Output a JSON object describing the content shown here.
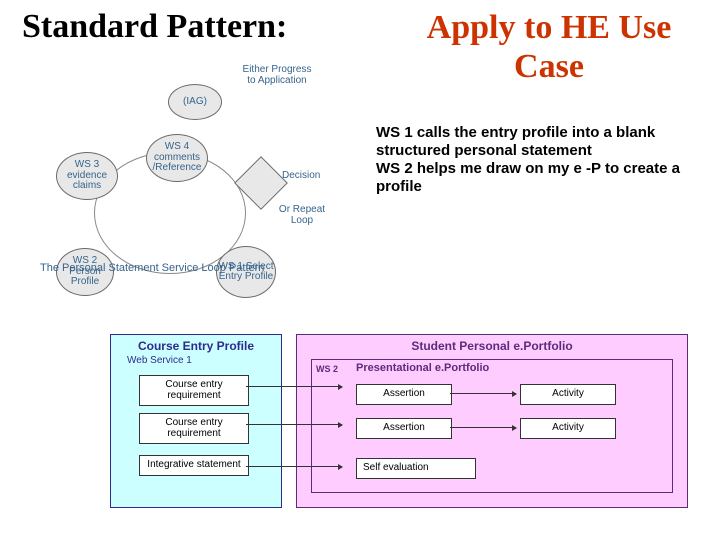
{
  "title_left": "Standard Pattern:",
  "title_right": "Apply to HE Use Case",
  "body": "WS 1 calls the entry profile into a blank structured personal statement\nWS 2 helps me draw on my   e -P to create a profile",
  "loop": {
    "iag": "(IAG)",
    "ws4": "WS 4 comments /Reference",
    "ws3": "WS 3 evidence claims",
    "ws2": "WS 2 Person Profile",
    "ws1": "WS 1 Select Entry Profile",
    "decision": "Decision",
    "either": "Either Progress to Application",
    "or": "Or Repeat Loop",
    "caption": "The Personal Statement Service Loop Pattern"
  },
  "bottom": {
    "left_title": "Course Entry Profile",
    "left_sub": "Web Service 1",
    "left_boxes": [
      "Course entry requirement",
      "Course entry requirement",
      "Integrative statement"
    ],
    "right_title": "Student Personal e.Portfolio",
    "ws2_tag": "WS 2",
    "ws2_title": "Presentational e.Portfolio",
    "r_col1": [
      "Assertion",
      "Assertion"
    ],
    "r_col2": [
      "Activity",
      "Activity"
    ],
    "self_eval": "Self evaluation"
  }
}
